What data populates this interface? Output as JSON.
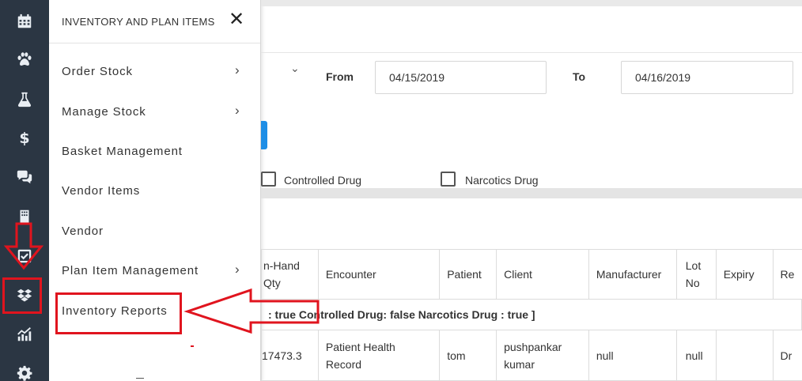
{
  "sidebar": {
    "icons": [
      {
        "name": "calendar-icon"
      },
      {
        "name": "paw-icon"
      },
      {
        "name": "flask-icon"
      },
      {
        "name": "dollar-icon",
        "glyph": "$"
      },
      {
        "name": "chat-icon"
      },
      {
        "name": "building-icon"
      },
      {
        "name": "checkbox-icon"
      },
      {
        "name": "dropbox-icon"
      },
      {
        "name": "chart-icon"
      },
      {
        "name": "gear-icon"
      }
    ]
  },
  "flyout": {
    "title": "INVENTORY AND PLAN ITEMS",
    "close_glyph": "✕",
    "items": [
      {
        "label": "Order Stock",
        "has_submenu": true,
        "chevron": "›"
      },
      {
        "label": "Manage Stock",
        "has_submenu": true,
        "chevron": "›"
      },
      {
        "label": "Basket Management",
        "has_submenu": false
      },
      {
        "label": "Vendor Items",
        "has_submenu": false
      },
      {
        "label": "Vendor",
        "has_submenu": false
      },
      {
        "label": "Plan Item Management",
        "has_submenu": true,
        "chevron": "›"
      },
      {
        "label": "Inventory Reports",
        "has_submenu": false
      }
    ]
  },
  "filters": {
    "dropdown_chevron": "⌄",
    "from_label": "From",
    "from_value": "04/15/2019",
    "to_label": "To",
    "to_value": "04/16/2019",
    "controlled_label": "Controlled Drug",
    "narcotics_label": "Narcotics Drug"
  },
  "table": {
    "headers": {
      "onhand": "n-Hand",
      "qty": "Qty",
      "encounter": "Encounter",
      "patient": "Patient",
      "client": "Client",
      "manufacturer": "Manufacturer",
      "lot": "Lot",
      "no": "No",
      "expiry": "Expiry",
      "re": "Re"
    },
    "group_row": ": true Controlled Drug: false Narcotics Drug : true ]",
    "rows": [
      {
        "onhand": "17473.3",
        "encounter_l1": "Patient Health",
        "encounter_l2": "Record",
        "patient": "tom",
        "client_l1": "pushpankar",
        "client_l2": "kumar",
        "manufacturer": "null",
        "lot": "null",
        "expiry": "",
        "re": "Dr"
      }
    ]
  },
  "annotations": {
    "color": "#e0141e"
  },
  "colors": {
    "sidebar_bg": "#2b3643",
    "accent_blue": "#1e8ee6",
    "annotation_red": "#e0141e"
  }
}
